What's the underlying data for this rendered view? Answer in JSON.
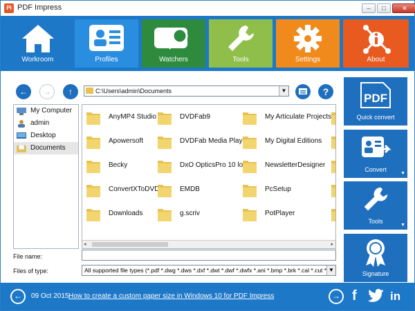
{
  "window": {
    "app_icon_text": "PI",
    "title": "PDF Impress"
  },
  "nav_tiles": [
    {
      "label": "Workroom",
      "color": "#1e78c8",
      "icon": "house-icon"
    },
    {
      "label": "Profiles",
      "color": "#2a8ee0",
      "icon": "profiles-icon"
    },
    {
      "label": "Watchers",
      "color": "#2e8b3e",
      "icon": "binoculars-icon"
    },
    {
      "label": "Tools",
      "color": "#8fbf4a",
      "icon": "wrench-icon"
    },
    {
      "label": "Settings",
      "color": "#f08a1c",
      "icon": "gear-icon"
    },
    {
      "label": "About",
      "color": "#e85a20",
      "icon": "info-icon"
    }
  ],
  "browser": {
    "back_glyph": "←",
    "forward_glyph": "→",
    "up_glyph": "↑",
    "path": "C:\\Users\\admin\\Documents",
    "help_glyph": "?",
    "tree": [
      {
        "label": "My Computer",
        "icon": "computer-icon",
        "selected": false
      },
      {
        "label": "admin",
        "icon": "user-icon",
        "selected": false
      },
      {
        "label": "Desktop",
        "icon": "desktop-icon",
        "selected": false
      },
      {
        "label": "Documents",
        "icon": "documents-icon",
        "selected": true
      }
    ],
    "files": [
      [
        "AnyMP4 Studio",
        "DVDFab9",
        "My Articulate Projects"
      ],
      [
        "Apowersoft",
        "DVDFab Media Player",
        "My Digital Editions"
      ],
      [
        "Becky",
        "DxO OpticsPro 10 logs",
        "NewsletterDesigner"
      ],
      [
        "ConvertXToDVD",
        "EMDB",
        "PcSetup"
      ],
      [
        "Downloads",
        "g.scriv",
        "PotPlayer"
      ]
    ],
    "file_name_label": "File name:",
    "file_name_value": "",
    "files_of_type_label": "Files of type:",
    "files_of_type_value": "All supported file types (*.pdf *.dwg *.dws *.dxf *.dwt *.dwf *.dwfx *.ani *.bmp *.brk *.cal *.cut *.c"
  },
  "right_tiles": [
    {
      "label": "Quick convert",
      "icon": "pdf-icon",
      "badge": "PDF",
      "has_menu": false
    },
    {
      "label": "Convert",
      "icon": "convert-icon",
      "has_menu": true
    },
    {
      "label": "Tools",
      "icon": "wrench-icon",
      "has_menu": true
    },
    {
      "label": "Signature",
      "icon": "ribbon-icon",
      "has_menu": false
    }
  ],
  "bottom": {
    "date": "09 Oct 2015:",
    "link": "How to create a custom paper size in Windows 10 for PDF Impress",
    "prev_glyph": "←",
    "next_glyph": "→",
    "facebook": "f",
    "linkedin": "in"
  }
}
